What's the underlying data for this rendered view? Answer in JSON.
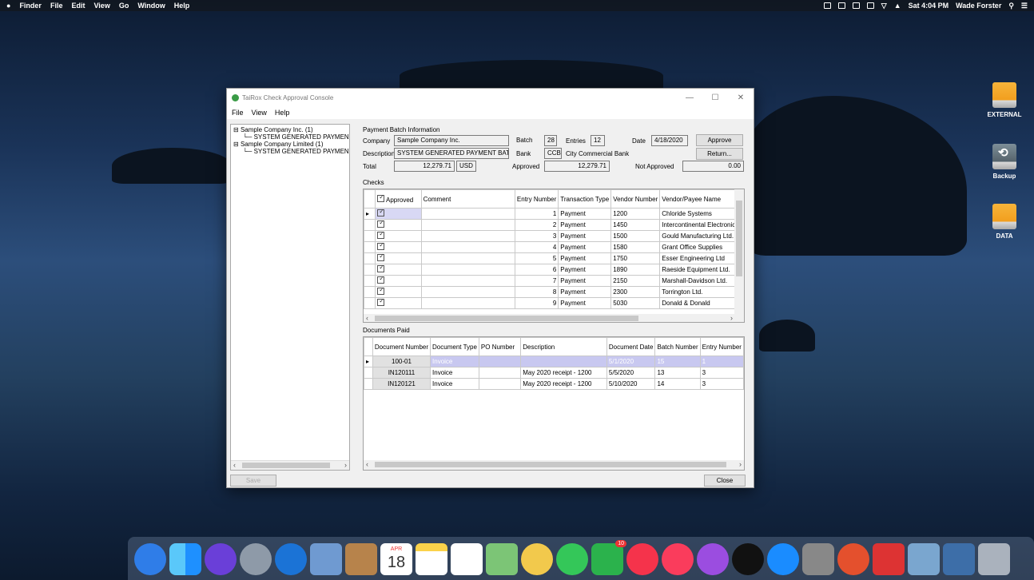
{
  "menubar": {
    "app": "Finder",
    "items": [
      "File",
      "Edit",
      "View",
      "Go",
      "Window",
      "Help"
    ],
    "clock": "Sat 4:04 PM",
    "user": "Wade Forster"
  },
  "desktop_icons": [
    {
      "label": "EXTERNAL",
      "icon": "external-drive-icon"
    },
    {
      "label": "Backup",
      "icon": "time-machine-drive-icon"
    },
    {
      "label": "DATA",
      "icon": "data-drive-icon"
    }
  ],
  "window": {
    "title": "TaiRox Check Approval Console",
    "menu": [
      "File",
      "View",
      "Help"
    ],
    "tree": {
      "nodes": [
        {
          "label": "Sample Company Inc. (1)",
          "children": [
            "SYSTEM GENERATED PAYMENT BA"
          ]
        },
        {
          "label": "Sample Company Limited (1)",
          "children": [
            "SYSTEM GENERATED PAYMENT BA"
          ]
        }
      ]
    },
    "batch": {
      "section_label": "Payment Batch Information",
      "company_label": "Company",
      "company": "Sample Company Inc.",
      "batch_label": "Batch",
      "batch": "28",
      "entries_label": "Entries",
      "entries": "12",
      "date_label": "Date",
      "date": "4/18/2020",
      "approve_button": "Approve",
      "description_label": "Description",
      "description": "SYSTEM GENERATED PAYMENT BATCH",
      "bank_label": "Bank",
      "bank": "CCB",
      "bank_name": "City Commercial Bank",
      "return_button": "Return...",
      "total_label": "Total",
      "total": "12,279.71",
      "currency": "USD",
      "approved_label": "Approved",
      "approved": "12,279.71",
      "not_approved_label": "Not Approved",
      "not_approved": "0.00"
    },
    "checks": {
      "section_label": "Checks",
      "columns": [
        "Approved",
        "Comment",
        "Entry Number",
        "Transaction Type",
        "Vendor Number",
        "Vendor/Payee Name"
      ],
      "rows": [
        {
          "entry": "1",
          "type": "Payment",
          "vendor": "1200",
          "name": "Chloride Systems"
        },
        {
          "entry": "2",
          "type": "Payment",
          "vendor": "1450",
          "name": "Intercontinental Electronics"
        },
        {
          "entry": "3",
          "type": "Payment",
          "vendor": "1500",
          "name": "Gould Manufacturing Ltd."
        },
        {
          "entry": "4",
          "type": "Payment",
          "vendor": "1580",
          "name": "Grant Office Supplies"
        },
        {
          "entry": "5",
          "type": "Payment",
          "vendor": "1750",
          "name": "Esser Engineering Ltd"
        },
        {
          "entry": "6",
          "type": "Payment",
          "vendor": "1890",
          "name": "Raeside Equipment Ltd."
        },
        {
          "entry": "7",
          "type": "Payment",
          "vendor": "2150",
          "name": "Marshall-Davidson Ltd."
        },
        {
          "entry": "8",
          "type": "Payment",
          "vendor": "2300",
          "name": "Torrington Ltd."
        },
        {
          "entry": "9",
          "type": "Payment",
          "vendor": "5030",
          "name": "Donald & Donald"
        }
      ]
    },
    "documents": {
      "section_label": "Documents Paid",
      "columns": [
        "Document Number",
        "Document Type",
        "PO Number",
        "Description",
        "Document Date",
        "Batch Number",
        "Entry Number"
      ],
      "rows": [
        {
          "number": "100-01",
          "type": "Invoice",
          "po": "",
          "description": "",
          "date": "5/1/2020",
          "batch": "15",
          "entry": "1"
        },
        {
          "number": "IN120111",
          "type": "Invoice",
          "po": "",
          "description": "May 2020 receipt - 1200",
          "date": "5/5/2020",
          "batch": "13",
          "entry": "3"
        },
        {
          "number": "IN120121",
          "type": "Invoice",
          "po": "",
          "description": "May 2020 receipt - 1200",
          "date": "5/10/2020",
          "batch": "14",
          "entry": "3"
        }
      ]
    },
    "save_button": "Save",
    "close_button": "Close"
  },
  "dock": {
    "calendar_month": "APR",
    "calendar_day": "18",
    "facetime_badge": "10"
  }
}
